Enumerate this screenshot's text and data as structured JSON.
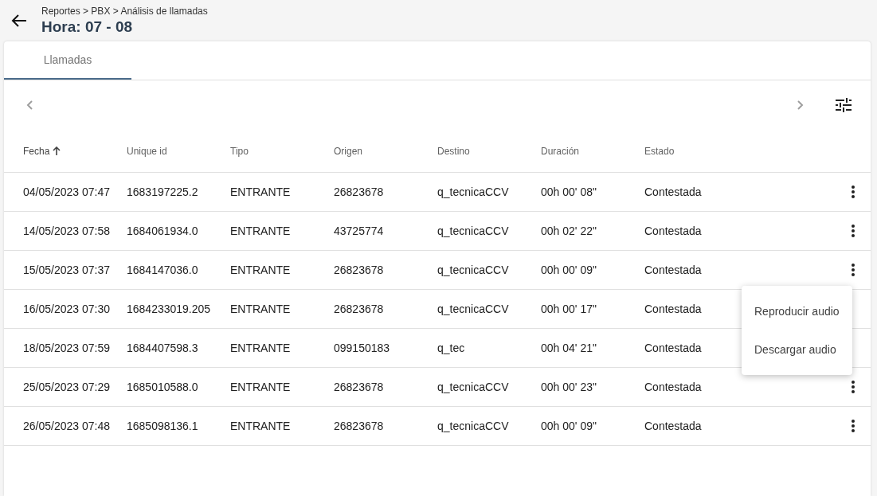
{
  "header": {
    "breadcrumb": "Reportes > PBX > Análisis de llamadas",
    "title": "Hora: 07 - 08"
  },
  "tabs": [
    {
      "label": "Llamadas",
      "selected": true
    }
  ],
  "table": {
    "columns": [
      {
        "label": "Fecha",
        "sorted": true
      },
      {
        "label": "Unique id",
        "sorted": false
      },
      {
        "label": "Tipo",
        "sorted": false
      },
      {
        "label": "Origen",
        "sorted": false
      },
      {
        "label": "Destino",
        "sorted": false
      },
      {
        "label": "Duración",
        "sorted": false
      },
      {
        "label": "Estado",
        "sorted": false
      }
    ],
    "rows": [
      {
        "cells": [
          "04/05/2023 07:47",
          "1683197225.2",
          "ENTRANTE",
          "26823678",
          "q_tecnicaCCV",
          "00h 00' 08\"",
          "Contestada"
        ],
        "menu_open": false
      },
      {
        "cells": [
          "14/05/2023 07:58",
          "1684061934.0",
          "ENTRANTE",
          "43725774",
          "q_tecnicaCCV",
          "00h 02' 22\"",
          "Contestada"
        ],
        "menu_open": false
      },
      {
        "cells": [
          "15/05/2023 07:37",
          "1684147036.0",
          "ENTRANTE",
          "26823678",
          "q_tecnicaCCV",
          "00h 00' 09\"",
          "Contestada"
        ],
        "menu_open": true
      },
      {
        "cells": [
          "16/05/2023 07:30",
          "1684233019.205",
          "ENTRANTE",
          "26823678",
          "q_tecnicaCCV",
          "00h 00' 17\"",
          "Contestada"
        ],
        "menu_open": false
      },
      {
        "cells": [
          "18/05/2023 07:59",
          "1684407598.3",
          "ENTRANTE",
          "099150183",
          "q_tec",
          "00h 04' 21\"",
          "Contestada"
        ],
        "menu_open": false
      },
      {
        "cells": [
          "25/05/2023 07:29",
          "1685010588.0",
          "ENTRANTE",
          "26823678",
          "q_tecnicaCCV",
          "00h 00' 23\"",
          "Contestada"
        ],
        "menu_open": false
      },
      {
        "cells": [
          "26/05/2023 07:48",
          "1685098136.1",
          "ENTRANTE",
          "26823678",
          "q_tecnicaCCV",
          "00h 00' 09\"",
          "Contestada"
        ],
        "menu_open": false
      }
    ]
  },
  "row_menu": {
    "items": [
      "Reproducir audio",
      "Descargar audio"
    ]
  }
}
